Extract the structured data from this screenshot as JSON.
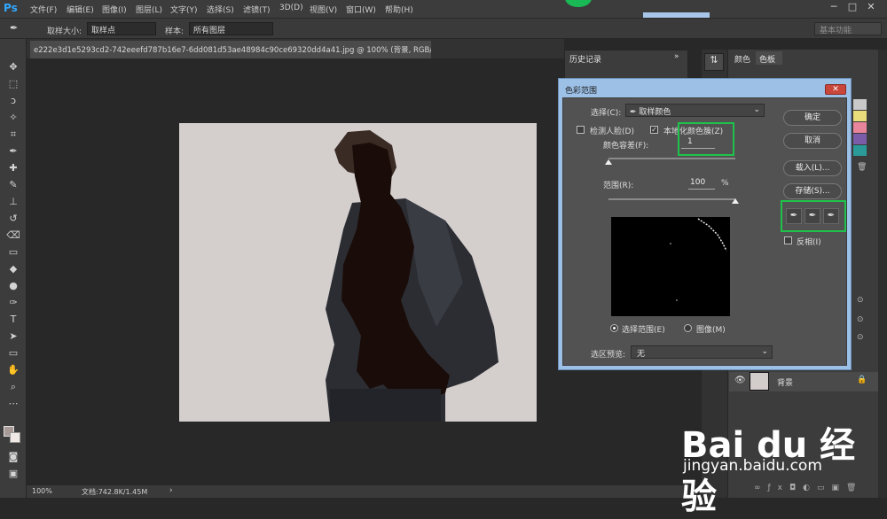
{
  "menubar": {
    "logo": "Ps",
    "items": [
      "文件(F)",
      "编辑(E)",
      "图像(I)",
      "图层(L)",
      "文字(Y)",
      "选择(S)",
      "滤镜(T)",
      "3D(D)",
      "视图(V)",
      "窗口(W)",
      "帮助(H)"
    ],
    "win_min": "─",
    "win_max": "□",
    "win_close": "✕"
  },
  "options": {
    "sample_size_label": "取样大小:",
    "sample_size_value": "取样点",
    "sample_label": "样本:",
    "sample_value": "所有图层",
    "workspace": "基本功能"
  },
  "document": {
    "tab_title": "e222e3d1e5293cd2-742eeefd787b16e7-6dd081d53ae48984c90ce69320dd4a41.jpg @ 100% (背景, RGB/8#) *",
    "zoom": "100%",
    "doc_info": "文档:742.8K/1.45M"
  },
  "panels": {
    "history_tab": "历史记录",
    "color_tab": "颜色",
    "swatches_tab": "色板",
    "layer_name": "背景"
  },
  "dialog": {
    "title": "色彩范围",
    "close": "✕",
    "select_label": "选择(C):",
    "select_value": "取样颜色",
    "detect_faces": "检测人脸(D)",
    "localized_clusters": "本地化颜色簇(Z)",
    "fuzziness_label": "颜色容差(F):",
    "fuzziness_value": "1",
    "range_label": "范围(R):",
    "range_value": "100",
    "range_unit": "%",
    "radio_selection": "选择范围(E)",
    "radio_image": "图像(M)",
    "preview_label": "选区预览:",
    "preview_value": "无",
    "btn_ok": "确定",
    "btn_cancel": "取消",
    "btn_load": "载入(L)...",
    "btn_save": "存储(S)...",
    "invert": "反相(I)",
    "fuzziness_level": 0.0,
    "range_level": 1.0
  },
  "watermark": {
    "logo": "Bai du 经验",
    "url": "jingyan.baidu.com"
  },
  "colors": {
    "highlight_green": "#1ec24a",
    "dialog_title_blue": "#9dc0e7",
    "ps_blue": "#31a8ff"
  }
}
